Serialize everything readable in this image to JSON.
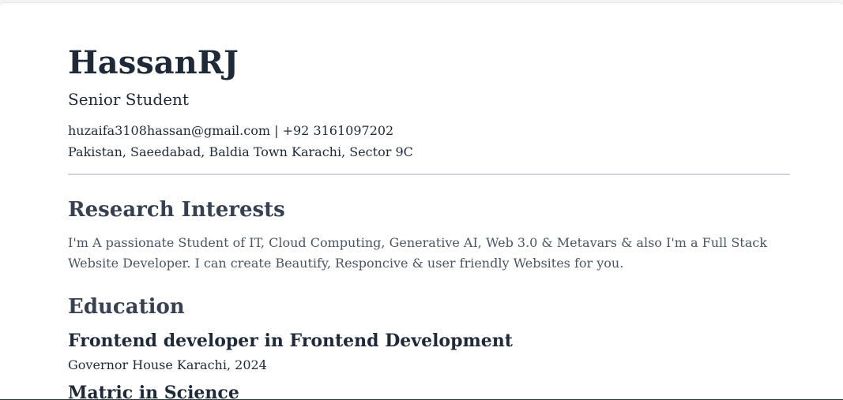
{
  "profile": {
    "name": "HassanRJ",
    "title": "Senior Student",
    "contact": "huzaifa3108hassan@gmail.com | +92 3161097202",
    "location": "Pakistan, Saeedabad, Baldia Town Karachi, Sector 9C"
  },
  "research": {
    "heading": "Research Interests",
    "text": "I'm A passionate Student of IT, Cloud Computing, Generative AI, Web 3.0 & Metavars & also I'm a Full Stack Website Developer. I can create Beautify, Responcive & user friendly Websites for you."
  },
  "education": {
    "heading": "Education",
    "items": [
      {
        "degree": "Frontend developer in Frontend Development",
        "institution": "Governor House Karachi, 2024"
      },
      {
        "degree": "Matric in Science"
      }
    ]
  }
}
